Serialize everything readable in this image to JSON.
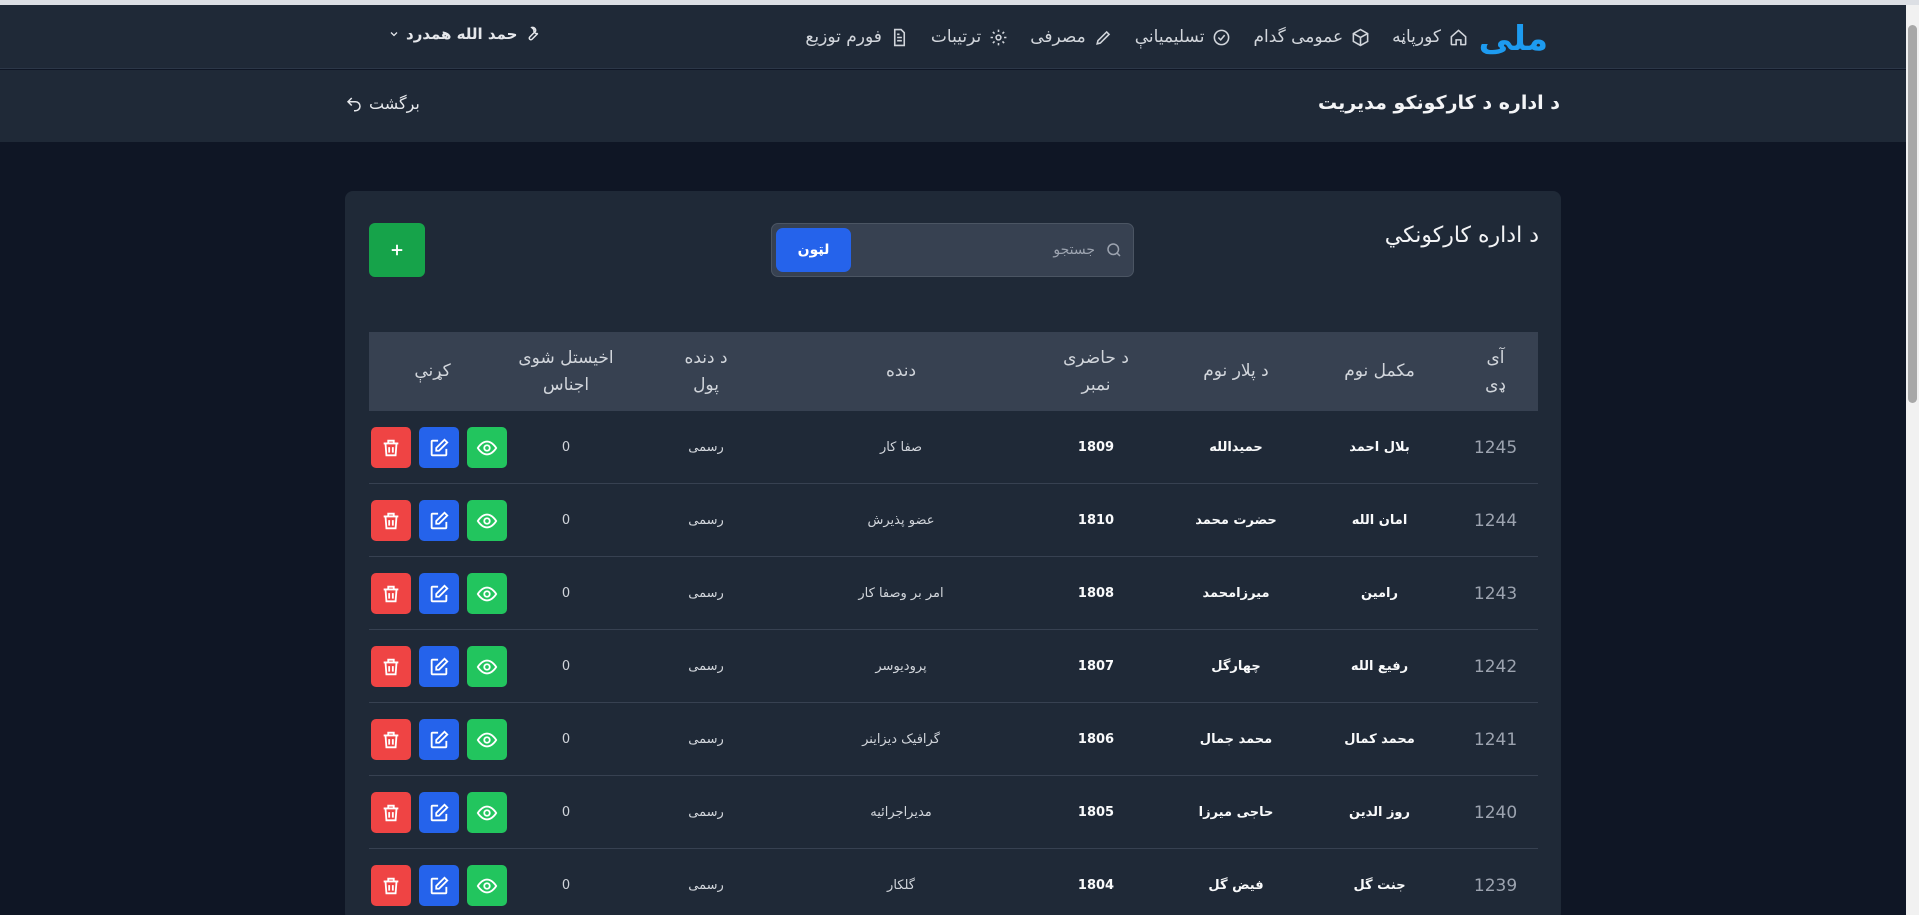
{
  "nav": {
    "logo": "ملی",
    "links": [
      {
        "label": "کورپاڼه",
        "icon": "home-icon"
      },
      {
        "label": "عمومی گدام",
        "icon": "box-icon"
      },
      {
        "label": "تسلیمیانې",
        "icon": "check-circle-icon"
      },
      {
        "label": "مصرفی",
        "icon": "pencil-icon"
      },
      {
        "label": "ترتیبات",
        "icon": "gear-icon"
      },
      {
        "label": "فورم توزیع",
        "icon": "document-icon"
      }
    ],
    "user": "حمد الله همدرد"
  },
  "subheader": {
    "title": "د اداره د کارکونکو مدیریت",
    "back": "برگشت"
  },
  "card": {
    "title": "د اداره کارکونکي",
    "search_placeholder": "جستجو",
    "search_button": "لټون"
  },
  "table": {
    "headers": {
      "id": "آی\nډی",
      "name": "مکمل نوم",
      "father": "د پلار نوم",
      "attendance": "د حاضری\nنمبر",
      "group": "دنده",
      "money": "د دنده\nپول",
      "goods": "اخیستل شوی\nاجناس",
      "actions": "کړنې"
    },
    "rows": [
      {
        "id": "1245",
        "name": "بلال احمد",
        "father": "حمیدالله",
        "attendance": "1809",
        "group": "صفا کار",
        "money": "رسمی",
        "goods": "0"
      },
      {
        "id": "1244",
        "name": "امان الله",
        "father": "حضرت محمد",
        "attendance": "1810",
        "group": "عضو پذیرش",
        "money": "رسمی",
        "goods": "0"
      },
      {
        "id": "1243",
        "name": "رامین",
        "father": "میرزامحمد",
        "attendance": "1808",
        "group": "امر بر وصفا کار",
        "money": "رسمی",
        "goods": "0"
      },
      {
        "id": "1242",
        "name": "رفیع الله",
        "father": "چهارگل",
        "attendance": "1807",
        "group": "پرودیوسر",
        "money": "رسمی",
        "goods": "0"
      },
      {
        "id": "1241",
        "name": "محمد کمال",
        "father": "محمد جمال",
        "attendance": "1806",
        "group": "گرافیک دیزاینر",
        "money": "رسمی",
        "goods": "0"
      },
      {
        "id": "1240",
        "name": "روز الدین",
        "father": "حاجی میرزا",
        "attendance": "1805",
        "group": "مدیراجرائیه",
        "money": "رسمی",
        "goods": "0"
      },
      {
        "id": "1239",
        "name": "جنت گل",
        "father": "فیض گل",
        "attendance": "1804",
        "group": "گلکار",
        "money": "رسمی",
        "goods": "0"
      }
    ]
  },
  "colors": {
    "bg": "#0f1625",
    "panel": "#1f2937",
    "view": "#22c55e",
    "edit": "#2563eb",
    "delete": "#ef4444",
    "add": "#16a34a",
    "logo": "#1d9bf0"
  }
}
